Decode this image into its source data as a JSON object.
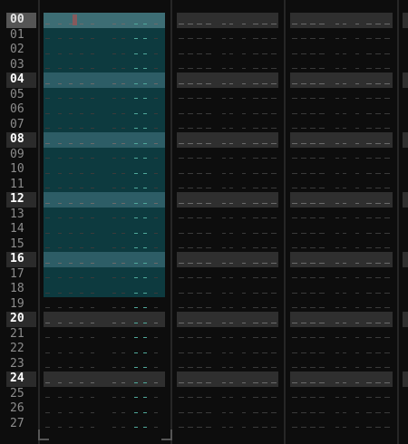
{
  "rows": [
    "00",
    "01",
    "02",
    "03",
    "04",
    "05",
    "06",
    "07",
    "08",
    "09",
    "10",
    "11",
    "12",
    "13",
    "14",
    "15",
    "16",
    "17",
    "18",
    "19",
    "20",
    "21",
    "22",
    "23",
    "24",
    "25",
    "26",
    "27"
  ],
  "highlight_every": 4,
  "cursor_row": 0,
  "selection": {
    "track": 0,
    "from_row": 0,
    "to_row": 18
  },
  "tracks": 4,
  "colors": {
    "background": "#0d0d0d",
    "selection": "#0d3a3f",
    "selection_highlight": "#2d5d66",
    "row_highlight": "#2f2f2f",
    "empty_cell_dash": "#3a3a3a",
    "effect_dash": "#4fa89a",
    "cursor": "#c24848"
  }
}
